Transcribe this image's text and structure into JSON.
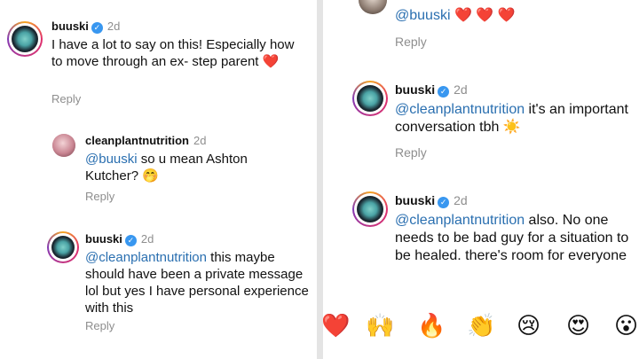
{
  "left": {
    "comments": [
      {
        "username": "buuski",
        "time": "2d",
        "text": "I have a lot to say on this! Especially how to move through an ex- step parent",
        "emoji": "❤️",
        "reply": "Reply"
      },
      {
        "username": "cleanplantnutrition",
        "time": "2d",
        "mention": "@buuski",
        "text": " so u mean Ashton Kutcher?",
        "emoji": "🤭",
        "reply": "Reply"
      },
      {
        "username": "buuski",
        "time": "2d",
        "mention": "@cleanplantnutrition",
        "text": " this maybe should have been a private message lol but yes I have personal experience with this",
        "reply": "Reply"
      }
    ]
  },
  "right": {
    "comments": [
      {
        "mention": "@buuski",
        "emoji": "❤️ ❤️ ❤️",
        "reply": "Reply"
      },
      {
        "username": "buuski",
        "time": "2d",
        "mention": "@cleanplantnutrition",
        "text": " it's an important conversation tbh",
        "emoji": "☀️",
        "reply": "Reply"
      },
      {
        "username": "buuski",
        "time": "2d",
        "mention": "@cleanplantnutrition",
        "text": " also. No one needs to be bad guy for a situation to be healed. there's room for everyone"
      }
    ],
    "reactions": [
      "❤️",
      "🙌",
      "🔥",
      "👏",
      "😢",
      "😍",
      "😮"
    ]
  },
  "icons": {
    "verified": "verified-badge-icon"
  },
  "colors": {
    "mention": "#2a6fb0",
    "muted": "#8e8e8e",
    "verified": "#3897f0",
    "heart": "#e0243b"
  }
}
